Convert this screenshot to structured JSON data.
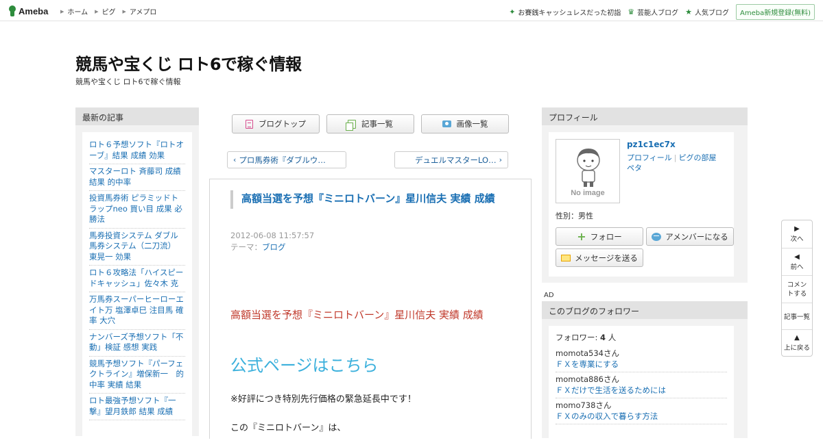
{
  "topbar": {
    "logo": "Ameba",
    "nav": [
      "ホーム",
      "ピグ",
      "アメプロ"
    ],
    "right": [
      {
        "icon": "sparkle-icon",
        "label": "お賽銭キャッシュレスだった初詣"
      },
      {
        "icon": "crown-icon",
        "label": "芸能人ブログ"
      },
      {
        "icon": "star-icon",
        "label": "人気ブログ"
      }
    ],
    "signup": "Ameba新規登録(無料)"
  },
  "header": {
    "title": "競馬や宝くじ ロト6で稼ぐ情報",
    "description": "競馬や宝くじ ロト6で稼ぐ情報"
  },
  "left": {
    "heading": "最新の記事",
    "items": [
      "ロト６予想ソフト『ロトオーブ』結果 成績 効果",
      "マスターロト 斉藤司 成績 結果 的中率",
      "投資馬券術 ピラミッドトラップneo 買い目 成果 必勝法",
      "馬券投資システム ダブル馬券システム（二刀流） 東晃一 効果",
      "ロト６攻略法「ハイスピードキャッシュ」佐々木 克",
      "万馬券スーパーヒーローエイト万 塩澤卓巳 注目馬 確率 大穴",
      "ナンバーズ予想ソフト「不動」検証 感想 実践",
      "競馬予想ソフト『パーフェクトライン』増保新一　的中率 実績 結果",
      "ロト最強予想ソフト『一撃』望月鉄郎 結果 成績"
    ]
  },
  "center": {
    "buttons": [
      "ブログトップ",
      "記事一覧",
      "画像一覧"
    ],
    "prev": "プロ馬券術『ダブルウ…",
    "next": "デュエルマスターLO…",
    "article": {
      "title": "高額当選を予想『ミニロトバーン』星川信夫 実績 成績",
      "date": "2012-06-08 11:57:57",
      "theme_label": "テーマ：",
      "theme": "ブログ",
      "red_text": "高額当選を予想『ミニロトバーン』星川信夫 実績 成績",
      "link_text": "公式ページはこちら",
      "p1": "※好評につき特別先行価格の緊急延長中です！",
      "p2": "この『ミニロトバーン』は、"
    }
  },
  "profile": {
    "heading": "プロフィール",
    "no_image": "No image",
    "name": "pz1c1ec7x",
    "links": [
      "プロフィール",
      "ピグの部屋",
      "ペタ"
    ],
    "gender": "性別：男性",
    "follow": "フォロー",
    "amember": "アメンバーになる",
    "message": "メッセージを送る"
  },
  "ad": "AD",
  "followers": {
    "heading": "このブログのフォロワー",
    "count_label": "フォロワー: ",
    "count": "4",
    "count_unit": " 人",
    "items": [
      {
        "name": "momota534さん",
        "title": "ＦＸを専業にする"
      },
      {
        "name": "momota886さん",
        "title": "ＦＸだけで生活を送るためには"
      },
      {
        "name": "momo738さん",
        "title": "ＦＸのみの収入で暮らす方法"
      }
    ]
  },
  "float_nav": {
    "next": "次へ",
    "prev": "前へ",
    "comment": "コメントする",
    "list": "記事一覧",
    "top": "上に戻る"
  }
}
